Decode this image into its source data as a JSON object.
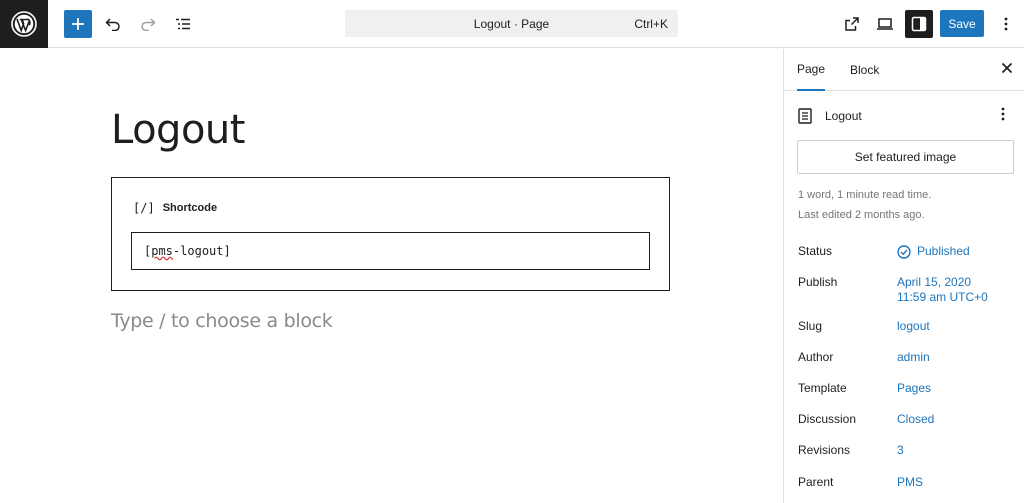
{
  "topbar": {
    "doc_title": "Logout · Page",
    "shortcut": "Ctrl+K",
    "save_label": "Save",
    "accent": "#1d75bc"
  },
  "icons": [
    "wordpress-logo",
    "plus-icon",
    "undo-icon",
    "redo-icon",
    "list-view-icon",
    "external-link-icon",
    "laptop-icon",
    "sidebar-icon",
    "more-vertical-icon",
    "close-icon",
    "page-icon",
    "check-circle-icon"
  ],
  "editor": {
    "title": "Logout",
    "shortcode_icon": "[/]",
    "shortcode_label": "Shortcode",
    "shortcode_prefix": "[",
    "shortcode_misspelled": "pms",
    "shortcode_suffix": "-logout]",
    "placeholder": "Type / to choose a block"
  },
  "sidebar": {
    "tabs": [
      {
        "label": "Page"
      },
      {
        "label": "Block"
      }
    ],
    "doc_name": "Logout",
    "featured_button": "Set featured image",
    "meta_line1": "1 word, 1 minute read time.",
    "meta_line2": "Last edited 2 months ago.",
    "fields": {
      "status": {
        "label": "Status",
        "value": "Published"
      },
      "publish": {
        "label": "Publish",
        "value_line1": "April 15, 2020",
        "value_line2": "11:59 am UTC+0"
      },
      "slug": {
        "label": "Slug",
        "value": "logout"
      },
      "author": {
        "label": "Author",
        "value": "admin"
      },
      "template": {
        "label": "Template",
        "value": "Pages"
      },
      "discussion": {
        "label": "Discussion",
        "value": "Closed"
      },
      "revisions": {
        "label": "Revisions",
        "value": "3"
      },
      "parent": {
        "label": "Parent",
        "value": "PMS"
      }
    }
  }
}
